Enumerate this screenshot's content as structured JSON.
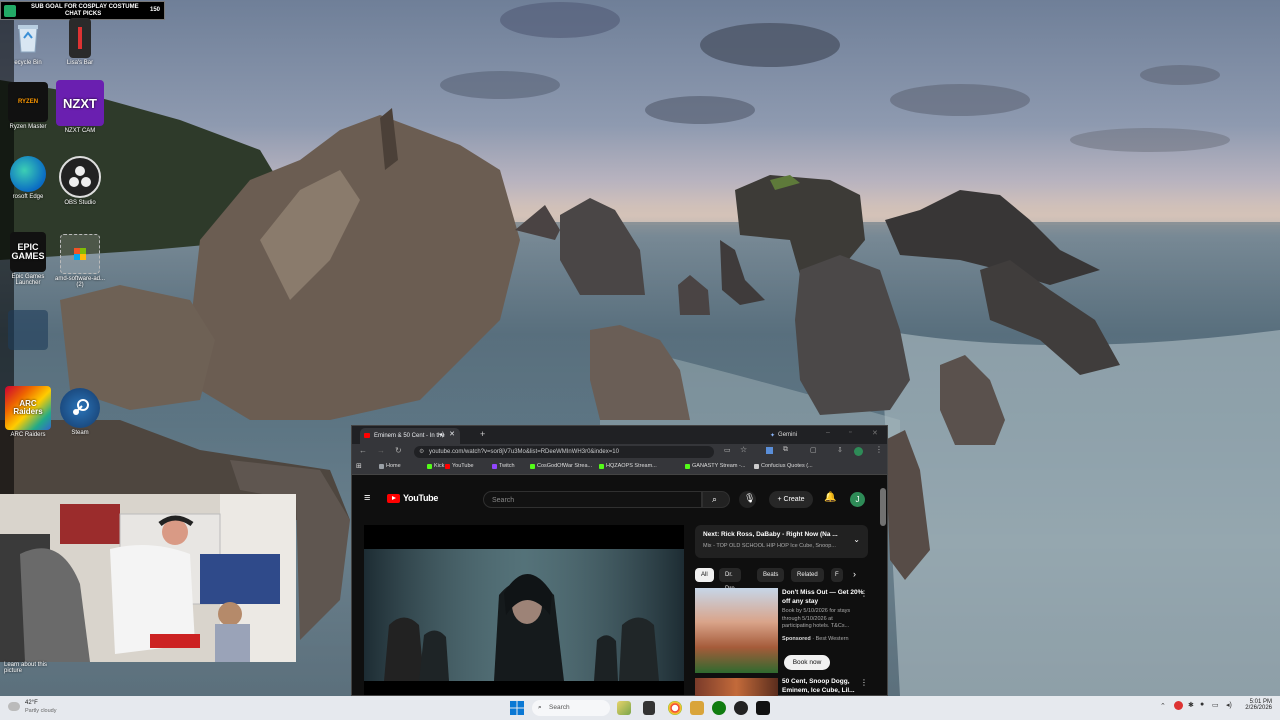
{
  "overlay": {
    "sub_goal_line1": "SUB GOAL FOR COSPLAY COSTUME",
    "sub_goal_line2": "CHAT PICKS",
    "sub_goal_count": "150"
  },
  "desktop_icons": [
    {
      "label": "ecycle Bin",
      "icon": "recycle-bin-icon"
    },
    {
      "label": "Lisa's Bar",
      "icon": "file-icon"
    },
    {
      "label": "Ryzen Master",
      "icon": "ryzen-icon",
      "text": "RYZEN"
    },
    {
      "label": "NZXT CAM",
      "icon": "nzxt-icon",
      "text": "NZXT"
    },
    {
      "label": "rosoft Edge",
      "icon": "edge-icon"
    },
    {
      "label": "OBS Studio",
      "icon": "obs-icon"
    },
    {
      "label": "Epic Games Launcher",
      "icon": "epic-games-icon",
      "text": "EPIC GAMES"
    },
    {
      "label": "amd-software-ad...(2)",
      "icon": "installer-icon"
    },
    {
      "label": "ARC Raiders",
      "icon": "arc-raiders-icon",
      "text": "ARC Raiders"
    },
    {
      "label": "Steam",
      "icon": "steam-icon"
    }
  ],
  "learn_about": "Learn about this picture",
  "browser": {
    "tab_title": "Eminem & 50 Cent - In the",
    "gemini_label": "Gemini",
    "url": "youtube.com/watch?v=sor8jV7u3Mo&list=RDeeWMInWH3r0&index=10",
    "bookmarks": [
      {
        "label": "Home",
        "color": "#9aa0a6"
      },
      {
        "label": "Kick",
        "color": "#53fc18"
      },
      {
        "label": "YouTube",
        "color": "#ff0000"
      },
      {
        "label": "Twitch",
        "color": "#9146ff"
      },
      {
        "label": "CosGodOfWar Strea...",
        "color": "#53fc18"
      },
      {
        "label": "HQZAOPS Stream...",
        "color": "#53fc18"
      },
      {
        "label": "GANASTY Stream -...",
        "color": "#53fc18"
      },
      {
        "label": "Confucius Quotes (...",
        "color": "#cccccc"
      }
    ]
  },
  "youtube": {
    "logo": "YouTube",
    "search_placeholder": "Search",
    "create_label": "Create",
    "avatar_letter": "J",
    "next_title": "Next: Rick Ross, DaBaby - Right Now (Na ...",
    "next_sub": "Mix - TOP OLD SCHOOL HIP HOP Ice Cube, Snoop...",
    "chips": [
      "All",
      "Dr. Dre",
      "Beats",
      "Related",
      "F"
    ],
    "ad": {
      "title": "Don't Miss Out — Get 20% off any stay",
      "body": "Book by 5/10/2026 for stays through 5/10/2026 at participating hotels. T&Cs...",
      "sponsored": "Sponsored",
      "advertiser": "· Best Western",
      "button": "Book now"
    },
    "next_video_title": "50 Cent, Snoop Dogg, Eminem, Ice Cube, Lil..."
  },
  "taskbar": {
    "weather_temp": "42°F",
    "weather_desc": "Partly cloudy",
    "search_label": "Search",
    "time": "5:01 PM",
    "date": "2/26/2026"
  }
}
